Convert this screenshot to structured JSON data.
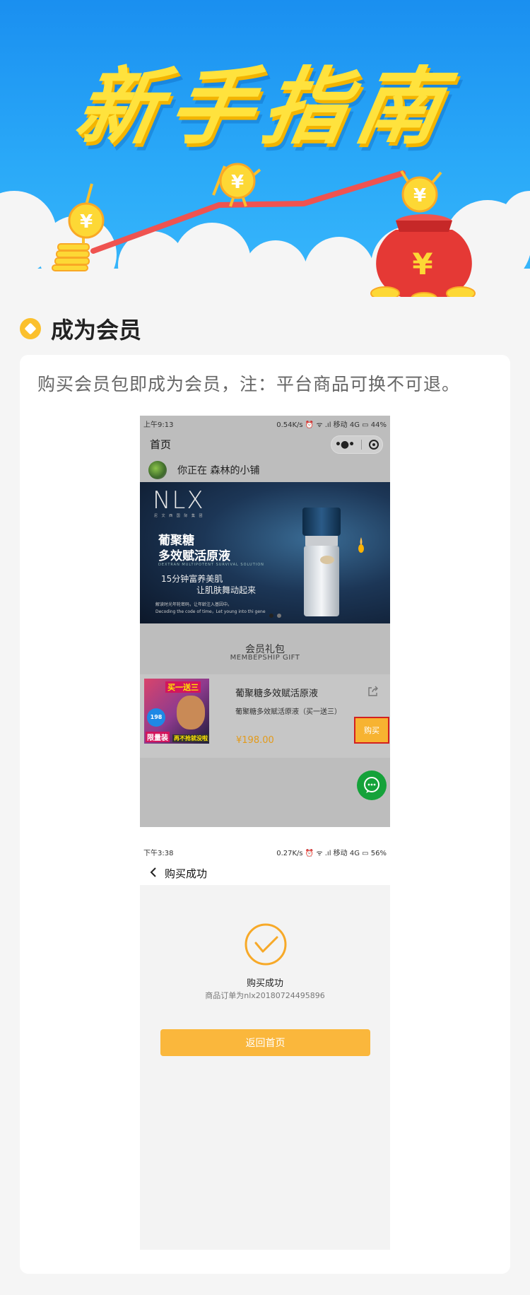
{
  "hero": {
    "title": "新手指南",
    "coin_symbol": "¥"
  },
  "section": {
    "title": "成为会员",
    "icon": "diamond-bullet-icon"
  },
  "card": {
    "description": "购买会员包即成为会员，注：平台商品可换不可退。"
  },
  "screen1": {
    "status_time": "上午9:13",
    "status_right": "0.54K/s ⏰ ᯤ .ıl 移动 4G ▭ 44%",
    "nav_title": "首页",
    "shop_text": "你正在 森林的小铺",
    "banner": {
      "logo": "NLX",
      "logo_sub": "尼 文 西 国 际 集 团",
      "line1": "葡聚糖",
      "line2": "多效赋活原液",
      "line_en": "DEXTRAN MULTIPOTENT SURVIVAL SOLUTION",
      "line3": "15分钟富养美肌",
      "line4": "让肌肤舞动起来",
      "line5": "解读时光年轮密码，让年龄注入基因中。",
      "line6": "Decoding the code of time，Let young into thi gene"
    },
    "gift_title": "会员礼包",
    "gift_subtitle": "MEMBEPSHIP GIFT",
    "product": {
      "tag": "买一送三",
      "badge": "198",
      "limit": "限量装",
      "limit2": "再不抢就没啦",
      "name": "葡聚糖多效赋活原液",
      "desc": "葡聚糖多效赋活原液（买一送三）",
      "price": "¥198.00",
      "buy_label": "购买"
    }
  },
  "screen2": {
    "status_time": "下午3:38",
    "status_right": "0.27K/s ⏰ ᯤ .ıl 移动 4G ▭ 56%",
    "nav_title": "购买成功",
    "success_title": "购买成功",
    "order_text": "商品订单为nlx20180724495896",
    "home_button": "返回首页"
  },
  "colors": {
    "accent": "#fab73c",
    "hero_blue": "#1a8ff0",
    "title_yellow": "#ffe23d",
    "buy_border": "#d32020",
    "chat_green": "#15a23a"
  }
}
